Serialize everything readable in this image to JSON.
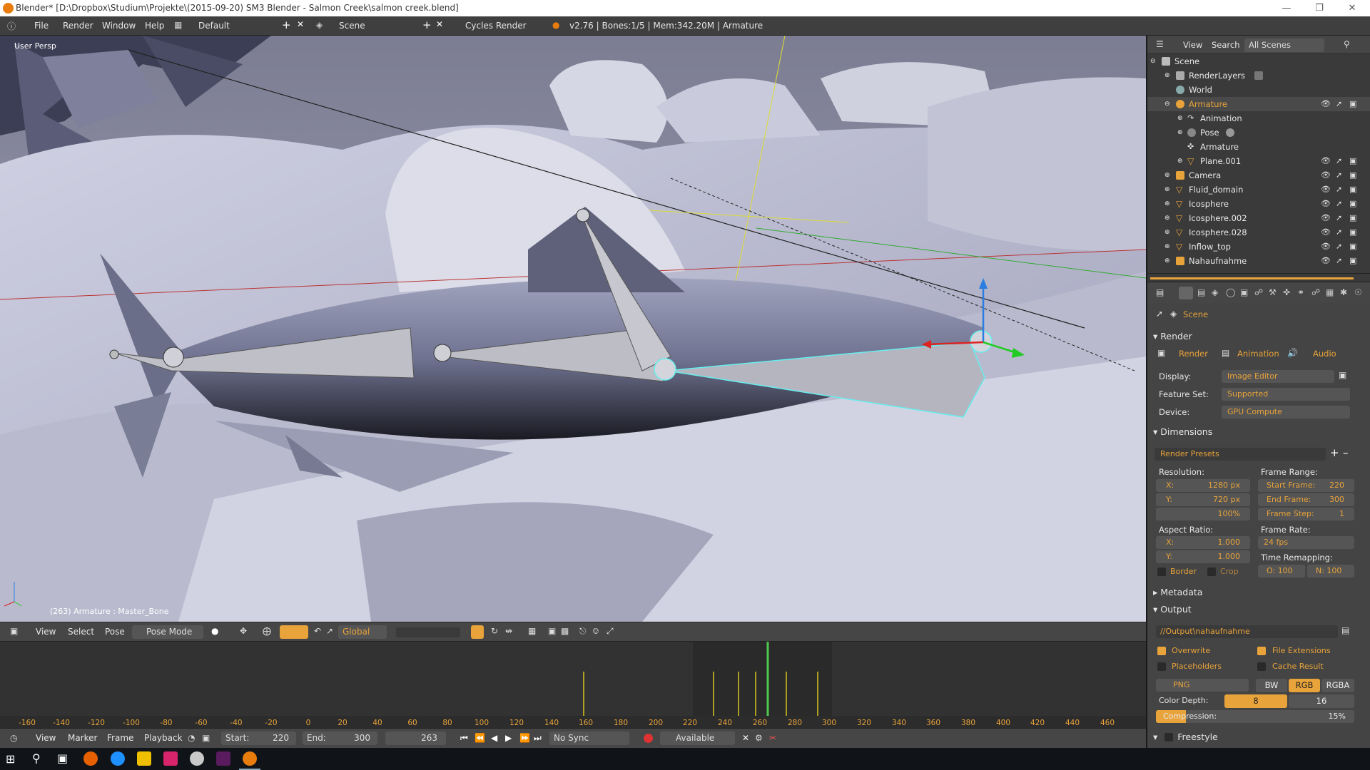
{
  "window": {
    "title": "Blender* [D:\\Dropbox\\Studium\\Projekte\\(2015-09-20) SM3 Blender - Salmon Creek\\salmon creek.blend]"
  },
  "info": {
    "menus": [
      "File",
      "Render",
      "Window",
      "Help"
    ],
    "layout": "Default",
    "scene": "Scene",
    "engine": "Cycles Render",
    "stats": "v2.76 | Bones:1/5 | Mem:342.20M | Armature"
  },
  "viewport": {
    "view_name": "User Persp",
    "status": "(263) Armature : Master_Bone"
  },
  "vp_header": {
    "menus": [
      "View",
      "Select",
      "Pose"
    ],
    "mode": "Pose Mode",
    "orientation": "Global"
  },
  "timeline": {
    "ticks": [
      "-160",
      "-140",
      "-120",
      "-100",
      "-80",
      "-60",
      "-40",
      "-20",
      "0",
      "20",
      "40",
      "60",
      "80",
      "100",
      "120",
      "140",
      "160",
      "180",
      "200",
      "220",
      "240",
      "260",
      "280",
      "300",
      "320",
      "340",
      "360",
      "380",
      "400",
      "420",
      "440",
      "460"
    ],
    "current_frame": 263
  },
  "tl_header": {
    "menus": [
      "View",
      "Marker",
      "Frame",
      "Playback"
    ],
    "start_label": "Start:",
    "start": "220",
    "end_label": "End:",
    "end": "300",
    "frame": "263",
    "sync": "No Sync",
    "keying": "Available"
  },
  "outliner": {
    "menus": [
      "View",
      "Search"
    ],
    "filter": "All Scenes",
    "rows": [
      {
        "name": "Scene",
        "indent": 0,
        "color": "#c8c8c8"
      },
      {
        "name": "RenderLayers",
        "indent": 1,
        "color": "#c8c8c8"
      },
      {
        "name": "World",
        "indent": 1,
        "color": "#c8c8c8"
      },
      {
        "name": "Armature",
        "indent": 1,
        "color": "#e8a33a",
        "orange": true
      },
      {
        "name": "Animation",
        "indent": 2,
        "color": "#c8c8c8"
      },
      {
        "name": "Pose",
        "indent": 2,
        "color": "#c8c8c8"
      },
      {
        "name": "Armature",
        "indent": 3,
        "color": "#c8c8c8"
      },
      {
        "name": "Plane.001",
        "indent": 2,
        "color": "#e8a33a"
      },
      {
        "name": "Camera",
        "indent": 1,
        "color": "#e8a33a"
      },
      {
        "name": "Fluid_domain",
        "indent": 1,
        "color": "#e8a33a"
      },
      {
        "name": "Icosphere",
        "indent": 1,
        "color": "#e8a33a"
      },
      {
        "name": "Icosphere.002",
        "indent": 1,
        "color": "#e8a33a"
      },
      {
        "name": "Icosphere.028",
        "indent": 1,
        "color": "#e8a33a"
      },
      {
        "name": "Inflow_top",
        "indent": 1,
        "color": "#e8a33a"
      },
      {
        "name": "Nahaufnahme",
        "indent": 1,
        "color": "#e8a33a"
      }
    ]
  },
  "props": {
    "context": "Scene",
    "render_section": "Render",
    "render_buttons": [
      "Render",
      "Animation",
      "Audio"
    ],
    "display_label": "Display:",
    "display": "Image Editor",
    "feature_label": "Feature Set:",
    "feature": "Supported",
    "device_label": "Device:",
    "device": "GPU Compute",
    "dimensions_section": "Dimensions",
    "presets": "Render Presets",
    "resolution_label": "Resolution:",
    "res_x_label": "X:",
    "res_x": "1280 px",
    "res_y_label": "Y:",
    "res_y": "720 px",
    "res_pct": "100%",
    "frame_range_label": "Frame Range:",
    "start_frame_label": "Start Frame:",
    "start_frame": "220",
    "end_frame_label": "End Frame:",
    "end_frame": "300",
    "frame_step_label": "Frame Step:",
    "frame_step": "1",
    "aspect_label": "Aspect Ratio:",
    "asp_x_label": "X:",
    "asp_x": "1.000",
    "asp_y_label": "Y:",
    "asp_y": "1.000",
    "frame_rate_label": "Frame Rate:",
    "frame_rate": "24 fps",
    "remap_label": "Time Remapping:",
    "remap_o": "O: 100",
    "remap_n": "N: 100",
    "border": "Border",
    "crop": "Crop",
    "metadata_section": "Metadata",
    "output_section": "Output",
    "output_path": "//Output\\nahaufnahme",
    "overwrite": "Overwrite",
    "file_ext": "File Extensions",
    "placeholders": "Placeholders",
    "cache": "Cache Result",
    "format": "PNG",
    "bw": "BW",
    "rgb": "RGB",
    "rgba": "RGBA",
    "depth_label": "Color Depth:",
    "depth_8": "8",
    "depth_16": "16",
    "compression_label": "Compression:",
    "compression": "15%",
    "compression_level": 0.15,
    "freestyle_section": "Freestyle"
  }
}
